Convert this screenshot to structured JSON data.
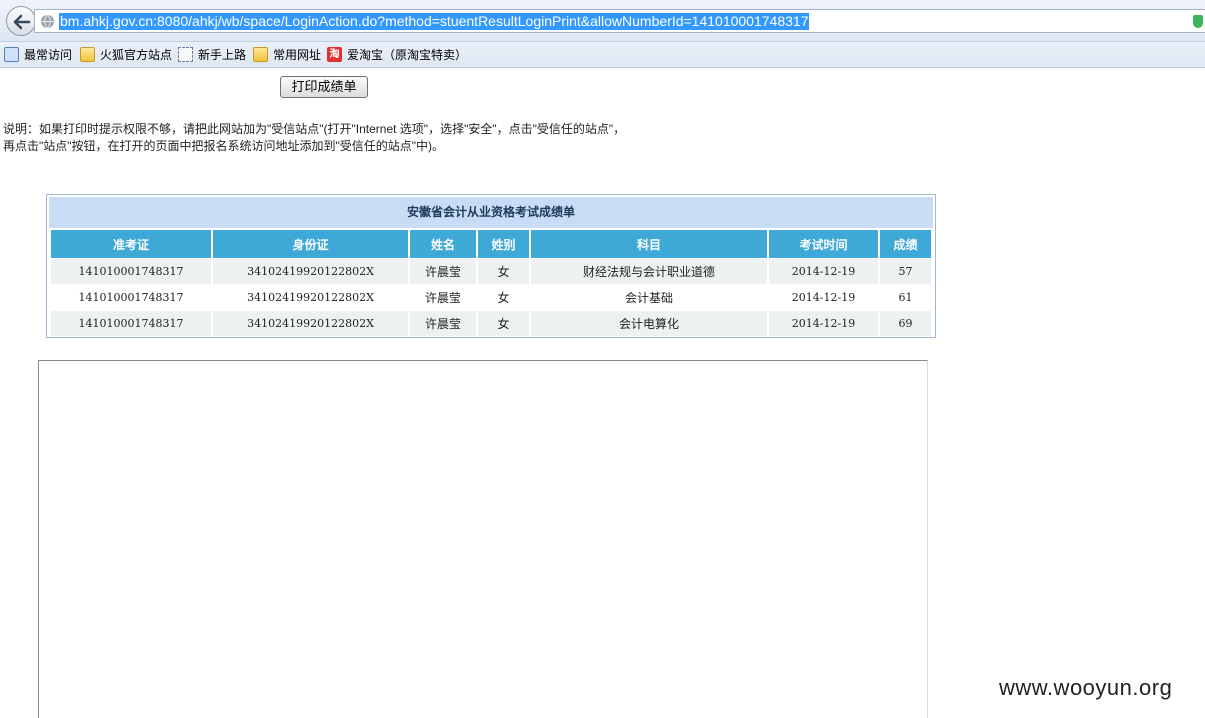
{
  "browser": {
    "url": "bm.ahkj.gov.cn:8080/ahkj/wb/space/LoginAction.do?method=stuentResultLoginPrint&allowNumberId=141010001748317",
    "bookmarks": [
      {
        "label": "最常访问",
        "icon": "search-icon"
      },
      {
        "label": "火狐官方站点",
        "icon": "folder-icon"
      },
      {
        "label": "新手上路",
        "icon": "page-icon"
      },
      {
        "label": "常用网址",
        "icon": "folder-icon"
      },
      {
        "label": "爱淘宝（原淘宝特卖）",
        "icon": "taobao-icon",
        "icon_text": "淘"
      }
    ]
  },
  "page": {
    "print_button_label": "打印成绩单",
    "note": "说明：如果打印时提示权限不够，请把此网站加为\"受信站点\"(打开\"Internet 选项\"，选择\"安全\"，点击\"受信任的站点\"，再点击\"站点\"按钮，在打开的页面中把报名系统访问地址添加到\"受信任的站点\"中)。",
    "score_table": {
      "title": "安徽省会计从业资格考试成绩单",
      "headers": [
        "准考证",
        "身份证",
        "姓名",
        "姓别",
        "科目",
        "考试时间",
        "成绩"
      ],
      "rows": [
        [
          "141010001748317",
          "34102419920122802X",
          "许晨莹",
          "女",
          "财经法规与会计职业道德",
          "2014-12-19",
          "57"
        ],
        [
          "141010001748317",
          "34102419920122802X",
          "许晨莹",
          "女",
          "会计基础",
          "2014-12-19",
          "61"
        ],
        [
          "141010001748317",
          "34102419920122802X",
          "许晨莹",
          "女",
          "会计电算化",
          "2014-12-19",
          "69"
        ]
      ]
    }
  },
  "watermark": "www.wooyun.org",
  "colors": {
    "header_cell": "#3ea8d6",
    "title_band": "#c8dcf5",
    "url_selection": "#3399ff"
  }
}
